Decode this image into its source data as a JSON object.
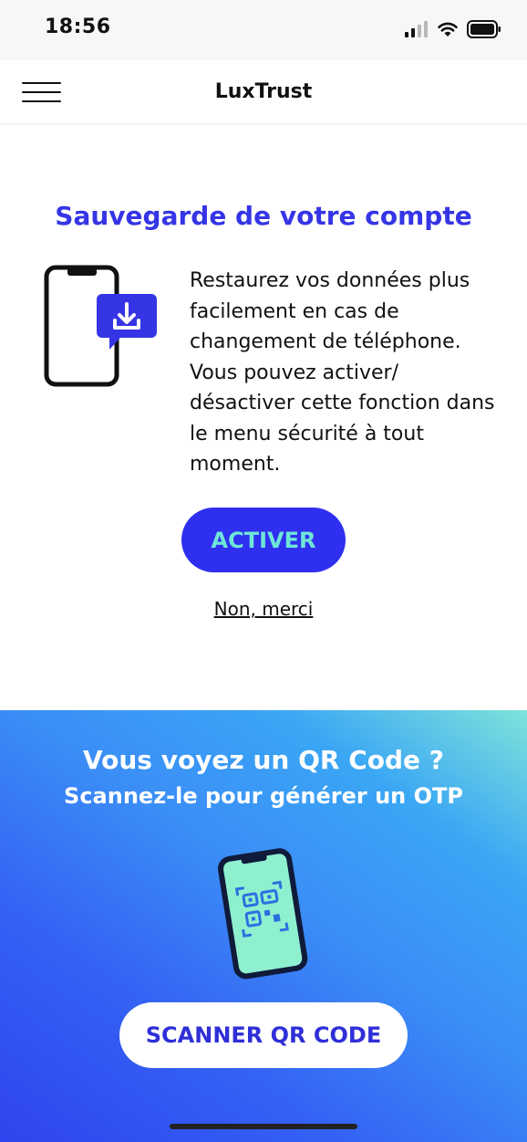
{
  "status_bar": {
    "time": "18:56",
    "icons": [
      "signal-icon",
      "wifi-icon",
      "battery-icon"
    ]
  },
  "header": {
    "menu_icon": "hamburger-menu-icon",
    "title": "LuxTrust"
  },
  "backup": {
    "title": "Sauvegarde de votre compte",
    "description": "Restaurez vos données plus facilement en cas de changement de téléphone. Vous pouvez activer/ désactiver cette fonction dans le menu sécurité à tout moment.",
    "illustration_icon": "phone-download-icon",
    "activate_label": "ACTIVER",
    "decline_label": "Non, merci"
  },
  "qr": {
    "title": "Vous voyez un QR Code ?",
    "subtitle": "Scannez-le pour générer un OTP",
    "illustration_icon": "phone-qr-code-icon",
    "scan_label": "SCANNER QR CODE"
  },
  "colors": {
    "accent": "#3535e6",
    "button_bg": "#2f2ff0",
    "button_text": "#6fe6d7",
    "gradient_start": "#7ee3da",
    "gradient_end": "#2f44ee"
  }
}
